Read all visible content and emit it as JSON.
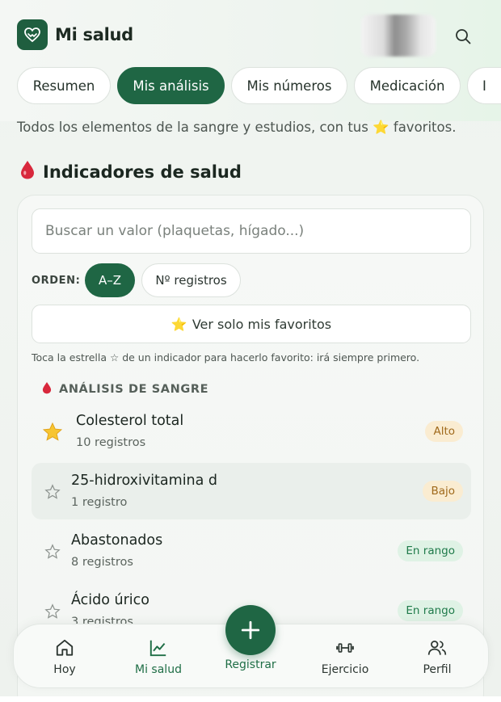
{
  "app": {
    "title": "Mi salud"
  },
  "tabs": [
    {
      "label": "Resumen"
    },
    {
      "label": "Mis análisis"
    },
    {
      "label": "Mis números"
    },
    {
      "label": "Medicación"
    },
    {
      "label": "I"
    }
  ],
  "subtitle": "Todos los elementos de la sangre y estudios, con tus ⭐ favoritos.",
  "section": {
    "icon": "🩸",
    "title": "Indicadores de salud"
  },
  "search": {
    "placeholder": "Buscar un valor (plaquetas, hígado...)",
    "value": ""
  },
  "order": {
    "label": "ORDEN:",
    "options": [
      "A–Z",
      "Nº registros"
    ],
    "selected": "A–Z"
  },
  "favorites_button": {
    "icon": "⭐",
    "label": "Ver solo mis favoritos"
  },
  "hint": "Toca la estrella ☆ de un indicador para hacerlo favorito: irá siempre primero.",
  "group": {
    "icon": "🩸",
    "title": "ANÁLISIS DE SANGRE"
  },
  "items": [
    {
      "name": "Colesterol total",
      "count": "10 registros",
      "status": "Alto",
      "favorite": true
    },
    {
      "name": "25-hidroxivitamina d",
      "count": "1 registro",
      "status": "Bajo",
      "favorite": false
    },
    {
      "name": "Abastonados",
      "count": "8 registros",
      "status": "En rango",
      "favorite": false
    },
    {
      "name": "Ácido úrico",
      "count": "3 registros",
      "status": "En rango",
      "favorite": false
    }
  ],
  "colors": {
    "accent": "#1f6644",
    "warn_bg": "#faecd1",
    "ok_bg": "#dff2e5"
  },
  "bottom_nav": [
    {
      "label": "Hoy",
      "icon": "home-icon"
    },
    {
      "label": "Mi salud",
      "icon": "chart-icon",
      "active": true
    },
    {
      "label": "Registrar",
      "icon": "plus-icon"
    },
    {
      "label": "Ejercicio",
      "icon": "dumbbell-icon"
    },
    {
      "label": "Perfil",
      "icon": "users-icon"
    }
  ]
}
